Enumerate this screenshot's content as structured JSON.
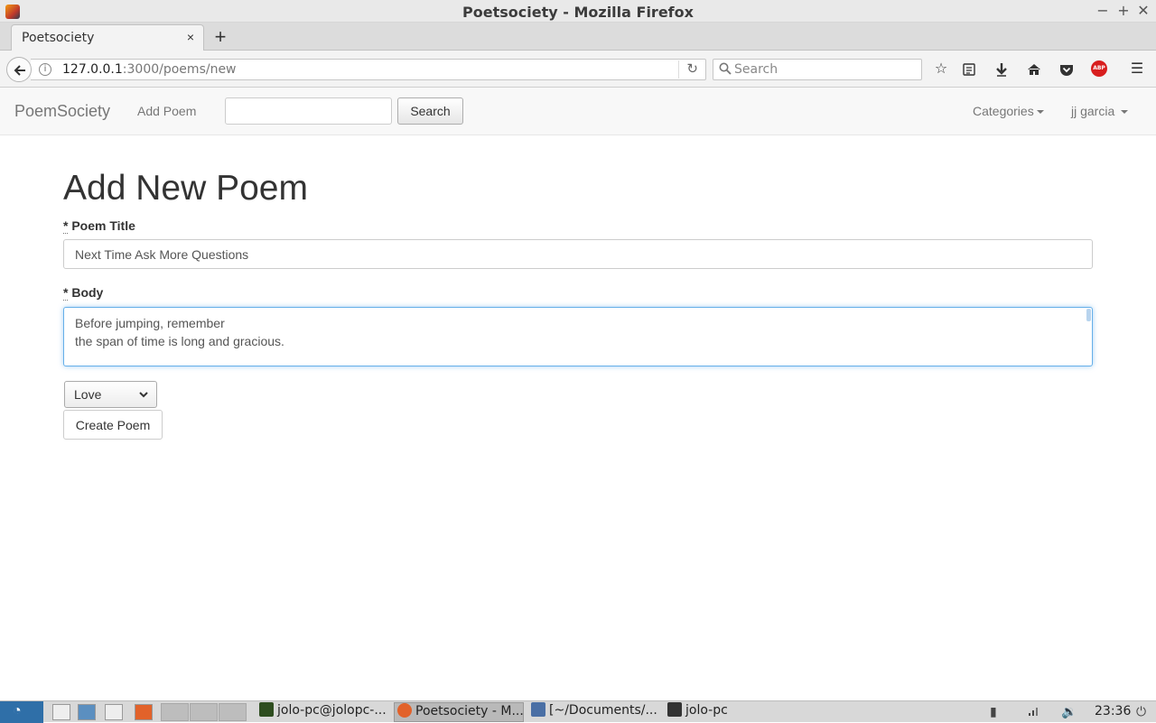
{
  "window": {
    "title": "Poetsociety - Mozilla Firefox",
    "minimize": "−",
    "maximize": "+",
    "close": "✕"
  },
  "tabs": [
    {
      "label": "Poetsociety",
      "close": "×",
      "active": true
    }
  ],
  "new_tab": "+",
  "toolbar": {
    "url_host": "127.0.0.1",
    "url_rest": ":3000/poems/new",
    "search_placeholder": "Search",
    "abp_label": "ABP"
  },
  "site_nav": {
    "brand": "PoemSociety",
    "add_poem": "Add Poem",
    "search_value": "",
    "search_button": "Search",
    "categories": "Categories",
    "user": "jj garcia"
  },
  "form": {
    "heading": "Add New Poem",
    "title_label": "Poem Title",
    "title_value": "Next Time Ask More Questions",
    "body_label": "Body",
    "body_value": "Before jumping, remember\nthe span of time is long and gracious.",
    "required_mark": "*",
    "category_selected": "Love",
    "submit_label": "Create Poem"
  },
  "taskbar": {
    "tasks": [
      {
        "label": "jolo-pc@jolopc-...",
        "icon_color": "#2e4d1f",
        "active": false
      },
      {
        "label": "Poetsociety - M...",
        "icon_color": "#e2622a",
        "active": true
      },
      {
        "label": "[~/Documents/...",
        "icon_color": "#4a6fa5",
        "active": false
      },
      {
        "label": "jolo-pc",
        "icon_color": "#333333",
        "active": false
      }
    ],
    "clock": "23:36"
  },
  "colors": {
    "focus_border": "#66afe9",
    "navbar_bg": "#f8f8f8",
    "abp_red": "#d81e1e"
  }
}
